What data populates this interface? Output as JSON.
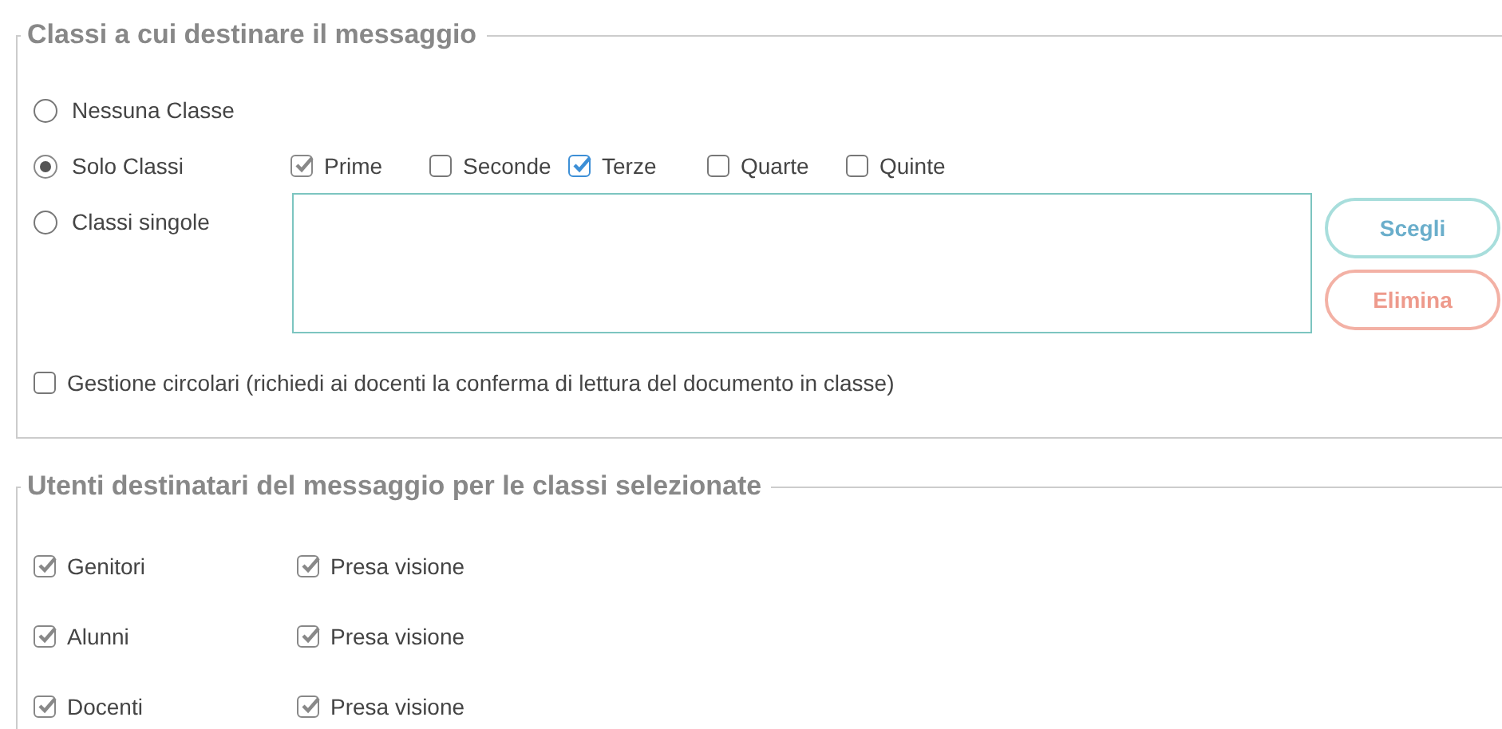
{
  "classes_section": {
    "legend": "Classi a cui destinare il messaggio",
    "options": [
      {
        "label": "Nessuna Classe",
        "selected": false
      },
      {
        "label": "Solo Classi",
        "selected": true
      },
      {
        "label": "Classi singole",
        "selected": false
      }
    ],
    "year_filters": [
      {
        "label": "Prime",
        "checked": true,
        "disabled": true
      },
      {
        "label": "Seconde",
        "checked": false,
        "disabled": false
      },
      {
        "label": "Terze",
        "checked": true,
        "disabled": false
      },
      {
        "label": "Quarte",
        "checked": false,
        "disabled": false
      },
      {
        "label": "Quinte",
        "checked": false,
        "disabled": false
      }
    ],
    "buttons": [
      {
        "label": "Scegli",
        "kind": "choose"
      },
      {
        "label": "Elimina",
        "kind": "delete"
      }
    ],
    "circulars": {
      "label": "Gestione circolari (richiedi ai docenti la conferma di lettura del documento in classe)",
      "checked": false,
      "disabled": false
    }
  },
  "recipients_section": {
    "legend": "Utenti destinatari del messaggio per le classi selezionate",
    "rows": [
      {
        "label": "Genitori",
        "checked": true,
        "disabled": true,
        "read_receipt": {
          "label": "Presa visione",
          "checked": true,
          "disabled": true
        }
      },
      {
        "label": "Alunni",
        "checked": true,
        "disabled": true,
        "read_receipt": {
          "label": "Presa visione",
          "checked": true,
          "disabled": true
        }
      },
      {
        "label": "Docenti",
        "checked": true,
        "disabled": true,
        "read_receipt": {
          "label": "Presa visione",
          "checked": true,
          "disabled": true
        }
      }
    ]
  }
}
